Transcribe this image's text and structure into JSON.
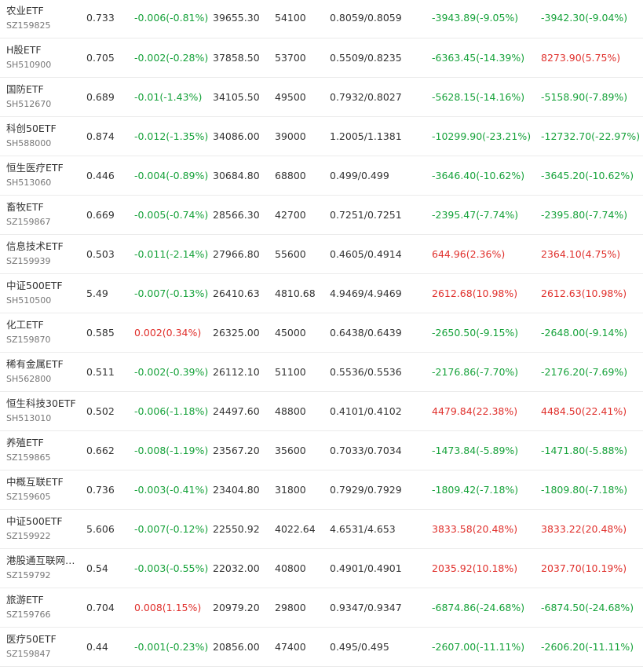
{
  "table": {
    "rows": [
      {
        "name": "农业ETF",
        "code": "SZ159825",
        "price": "0.733",
        "change": "-0.006(-0.81%)",
        "change_dir": "down",
        "amount": "39655.30",
        "volume": "54100",
        "bid_ask": "0.8059/0.8059",
        "premium1": "-3943.89(-9.05%)",
        "premium1_dir": "down",
        "premium2": "-3942.30(-9.04%)",
        "premium2_dir": "down"
      },
      {
        "name": "H股ETF",
        "code": "SH510900",
        "price": "0.705",
        "change": "-0.002(-0.28%)",
        "change_dir": "down",
        "amount": "37858.50",
        "volume": "53700",
        "bid_ask": "0.5509/0.8235",
        "premium1": "-6363.45(-14.39%)",
        "premium1_dir": "down",
        "premium2": "8273.90(5.75%)",
        "premium2_dir": "up"
      },
      {
        "name": "国防ETF",
        "code": "SH512670",
        "price": "0.689",
        "change": "-0.01(-1.43%)",
        "change_dir": "down",
        "amount": "34105.50",
        "volume": "49500",
        "bid_ask": "0.7932/0.8027",
        "premium1": "-5628.15(-14.16%)",
        "premium1_dir": "down",
        "premium2": "-5158.90(-7.89%)",
        "premium2_dir": "down"
      },
      {
        "name": "科创50ETF",
        "code": "SH588000",
        "price": "0.874",
        "change": "-0.012(-1.35%)",
        "change_dir": "down",
        "amount": "34086.00",
        "volume": "39000",
        "bid_ask": "1.2005/1.1381",
        "premium1": "-10299.90(-23.21%)",
        "premium1_dir": "down",
        "premium2": "-12732.70(-22.97%)",
        "premium2_dir": "down"
      },
      {
        "name": "恒生医疗ETF",
        "code": "SH513060",
        "price": "0.446",
        "change": "-0.004(-0.89%)",
        "change_dir": "down",
        "amount": "30684.80",
        "volume": "68800",
        "bid_ask": "0.499/0.499",
        "premium1": "-3646.40(-10.62%)",
        "premium1_dir": "down",
        "premium2": "-3645.20(-10.62%)",
        "premium2_dir": "down"
      },
      {
        "name": "畜牧ETF",
        "code": "SZ159867",
        "price": "0.669",
        "change": "-0.005(-0.74%)",
        "change_dir": "down",
        "amount": "28566.30",
        "volume": "42700",
        "bid_ask": "0.7251/0.7251",
        "premium1": "-2395.47(-7.74%)",
        "premium1_dir": "down",
        "premium2": "-2395.80(-7.74%)",
        "premium2_dir": "down"
      },
      {
        "name": "信息技术ETF",
        "code": "SZ159939",
        "price": "0.503",
        "change": "-0.011(-2.14%)",
        "change_dir": "down",
        "amount": "27966.80",
        "volume": "55600",
        "bid_ask": "0.4605/0.4914",
        "premium1": "644.96(2.36%)",
        "premium1_dir": "up",
        "premium2": "2364.10(4.75%)",
        "premium2_dir": "up"
      },
      {
        "name": "中证500ETF",
        "code": "SH510500",
        "price": "5.49",
        "change": "-0.007(-0.13%)",
        "change_dir": "down",
        "amount": "26410.63",
        "volume": "4810.68",
        "bid_ask": "4.9469/4.9469",
        "premium1": "2612.68(10.98%)",
        "premium1_dir": "up",
        "premium2": "2612.63(10.98%)",
        "premium2_dir": "up"
      },
      {
        "name": "化工ETF",
        "code": "SZ159870",
        "price": "0.585",
        "change": "0.002(0.34%)",
        "change_dir": "up",
        "amount": "26325.00",
        "volume": "45000",
        "bid_ask": "0.6438/0.6439",
        "premium1": "-2650.50(-9.15%)",
        "premium1_dir": "down",
        "premium2": "-2648.00(-9.14%)",
        "premium2_dir": "down"
      },
      {
        "name": "稀有金属ETF",
        "code": "SH562800",
        "price": "0.511",
        "change": "-0.002(-0.39%)",
        "change_dir": "down",
        "amount": "26112.10",
        "volume": "51100",
        "bid_ask": "0.5536/0.5536",
        "premium1": "-2176.86(-7.70%)",
        "premium1_dir": "down",
        "premium2": "-2176.20(-7.69%)",
        "premium2_dir": "down"
      },
      {
        "name": "恒生科技30ETF",
        "code": "SH513010",
        "price": "0.502",
        "change": "-0.006(-1.18%)",
        "change_dir": "down",
        "amount": "24497.60",
        "volume": "48800",
        "bid_ask": "0.4101/0.4102",
        "premium1": "4479.84(22.38%)",
        "premium1_dir": "up",
        "premium2": "4484.50(22.41%)",
        "premium2_dir": "up"
      },
      {
        "name": "养殖ETF",
        "code": "SZ159865",
        "price": "0.662",
        "change": "-0.008(-1.19%)",
        "change_dir": "down",
        "amount": "23567.20",
        "volume": "35600",
        "bid_ask": "0.7033/0.7034",
        "premium1": "-1473.84(-5.89%)",
        "premium1_dir": "down",
        "premium2": "-1471.80(-5.88%)",
        "premium2_dir": "down"
      },
      {
        "name": "中概互联ETF",
        "code": "SZ159605",
        "price": "0.736",
        "change": "-0.003(-0.41%)",
        "change_dir": "down",
        "amount": "23404.80",
        "volume": "31800",
        "bid_ask": "0.7929/0.7929",
        "premium1": "-1809.42(-7.18%)",
        "premium1_dir": "down",
        "premium2": "-1809.80(-7.18%)",
        "premium2_dir": "down"
      },
      {
        "name": "中证500ETF",
        "code": "SZ159922",
        "price": "5.606",
        "change": "-0.007(-0.12%)",
        "change_dir": "down",
        "amount": "22550.92",
        "volume": "4022.64",
        "bid_ask": "4.6531/4.653",
        "premium1": "3833.58(20.48%)",
        "premium1_dir": "up",
        "premium2": "3833.22(20.48%)",
        "premium2_dir": "up"
      },
      {
        "name": "港股通互联网…",
        "code": "SZ159792",
        "price": "0.54",
        "change": "-0.003(-0.55%)",
        "change_dir": "down",
        "amount": "22032.00",
        "volume": "40800",
        "bid_ask": "0.4901/0.4901",
        "premium1": "2035.92(10.18%)",
        "premium1_dir": "up",
        "premium2": "2037.70(10.19%)",
        "premium2_dir": "up"
      },
      {
        "name": "旅游ETF",
        "code": "SZ159766",
        "price": "0.704",
        "change": "0.008(1.15%)",
        "change_dir": "up",
        "amount": "20979.20",
        "volume": "29800",
        "bid_ask": "0.9347/0.9347",
        "premium1": "-6874.86(-24.68%)",
        "premium1_dir": "down",
        "premium2": "-6874.50(-24.68%)",
        "premium2_dir": "down"
      },
      {
        "name": "医疗50ETF",
        "code": "SZ159847",
        "price": "0.44",
        "change": "-0.001(-0.23%)",
        "change_dir": "down",
        "amount": "20856.00",
        "volume": "47400",
        "bid_ask": "0.495/0.495",
        "premium1": "-2607.00(-11.11%)",
        "premium1_dir": "down",
        "premium2": "-2606.20(-11.11%)",
        "premium2_dir": "down"
      }
    ]
  },
  "colors": {
    "up": "#e0302c",
    "down": "#16a23a",
    "neutral": "#333333",
    "code": "#777777",
    "row_border": "#ebebeb"
  }
}
